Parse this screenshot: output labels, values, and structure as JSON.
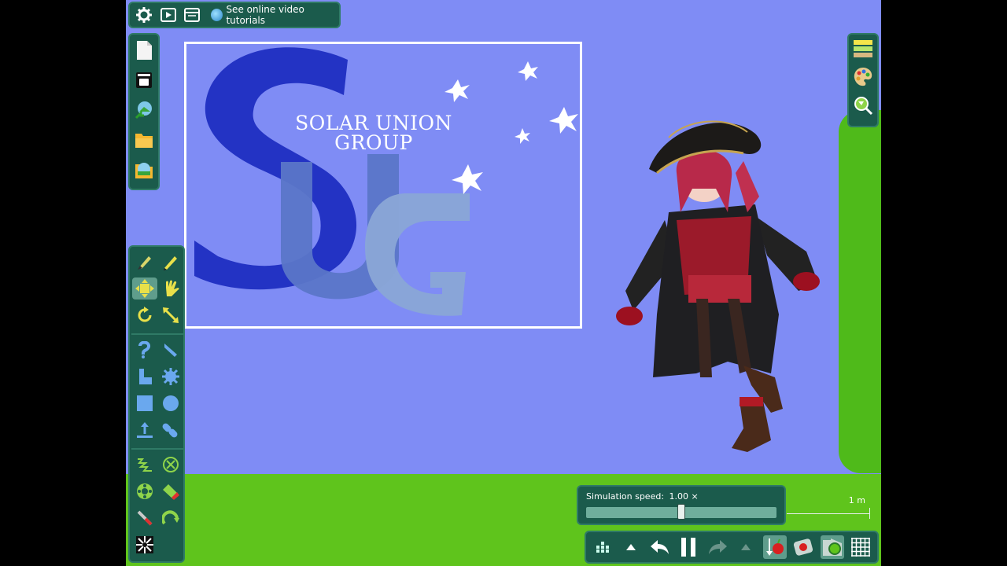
{
  "toolbar": {
    "settings_icon": "gear-icon",
    "play_icon": "play-icon",
    "window_icon": "window-icon",
    "tutorial_link": "See online video tutorials"
  },
  "file_panel": {
    "items": [
      "new-file-icon",
      "toolbar-icon",
      "web-scene-icon",
      "folder-open-icon",
      "scenes-icon"
    ]
  },
  "tools": [
    "brush-icon",
    "pencil-icon",
    "move-icon",
    "drag-icon",
    "rotate-icon",
    "scale-icon",
    "polygon-icon",
    "knife-icon",
    "plane-icon",
    "gear-icon",
    "box-icon",
    "circle-icon",
    "upload-icon",
    "chain-icon",
    "spring-icon",
    "fixate-icon",
    "axle-icon",
    "eraser-icon",
    "laser-icon",
    "hinge-icon",
    "tracer-icon"
  ],
  "scene": {
    "billboard_text": "SOLAR UNION\nGROUP",
    "logo_letters": [
      "S",
      "U",
      "G"
    ]
  },
  "simulation": {
    "label": "Simulation speed:",
    "speed": "1.00 ×",
    "speed_fraction": 0.5
  },
  "scale_label": "1 m",
  "colors": {
    "background": "#7f8cf5",
    "ground": "#5fc41c",
    "panel": "#1b5b4c",
    "panel_border": "#2f7a66"
  }
}
